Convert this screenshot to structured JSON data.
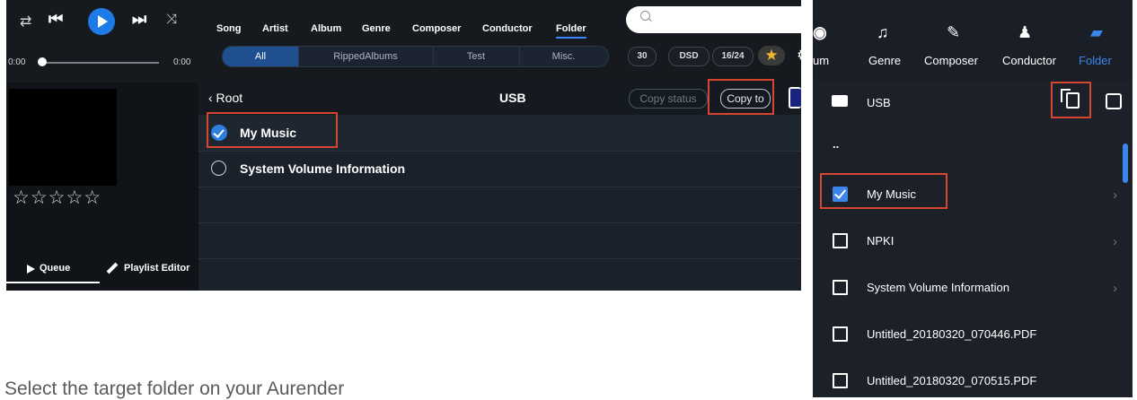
{
  "desktop": {
    "player": {
      "time_start": "0:00",
      "time_end": "0:00",
      "icons": [
        "repeat-icon",
        "previous-icon",
        "play-icon",
        "next-icon",
        "shuffle-icon"
      ]
    },
    "rating_stars": "☆☆☆☆☆",
    "queue_label": "Queue",
    "playlist_label": "Playlist Editor",
    "nav": [
      "Song",
      "Artist",
      "Album",
      "Genre",
      "Composer",
      "Conductor",
      "Folder"
    ],
    "nav_active": "Folder",
    "filters": [
      "All",
      "RippedAlbums",
      "Test",
      "Misc."
    ],
    "filter_active": "All",
    "pills": [
      "30",
      "DSD",
      "16/24"
    ],
    "back_label": "‹ Root",
    "current_folder": "USB",
    "copy_status_label": "Copy status",
    "copy_to_label": "Copy to",
    "rows": [
      {
        "label": "My Music",
        "checked": true
      },
      {
        "label": "System Volume Information",
        "checked": false
      }
    ]
  },
  "mobile": {
    "tabs": [
      {
        "label": "um",
        "icon": "album-icon"
      },
      {
        "label": "Genre",
        "icon": "genre-icon"
      },
      {
        "label": "Composer",
        "icon": "composer-icon"
      },
      {
        "label": "Conductor",
        "icon": "conductor-icon"
      },
      {
        "label": "Folder",
        "icon": "folder-icon"
      }
    ],
    "active_tab": "Folder",
    "current_folder": "USB",
    "parent_label": "..",
    "rows": [
      {
        "label": "My Music",
        "checked": true,
        "chevron": true
      },
      {
        "label": "NPKI",
        "checked": false,
        "chevron": true
      },
      {
        "label": "System Volume Information",
        "checked": false,
        "chevron": true
      },
      {
        "label": "Untitled_20180320_070446.PDF",
        "checked": false,
        "chevron": false
      },
      {
        "label": "Untitled_20180320_070515.PDF",
        "checked": false,
        "chevron": false
      }
    ]
  },
  "caption": "Select the target folder on your Aurender",
  "colors": {
    "accent": "#2f7fe0",
    "highlight": "#d64530",
    "active_tab": "#3b86ff"
  }
}
